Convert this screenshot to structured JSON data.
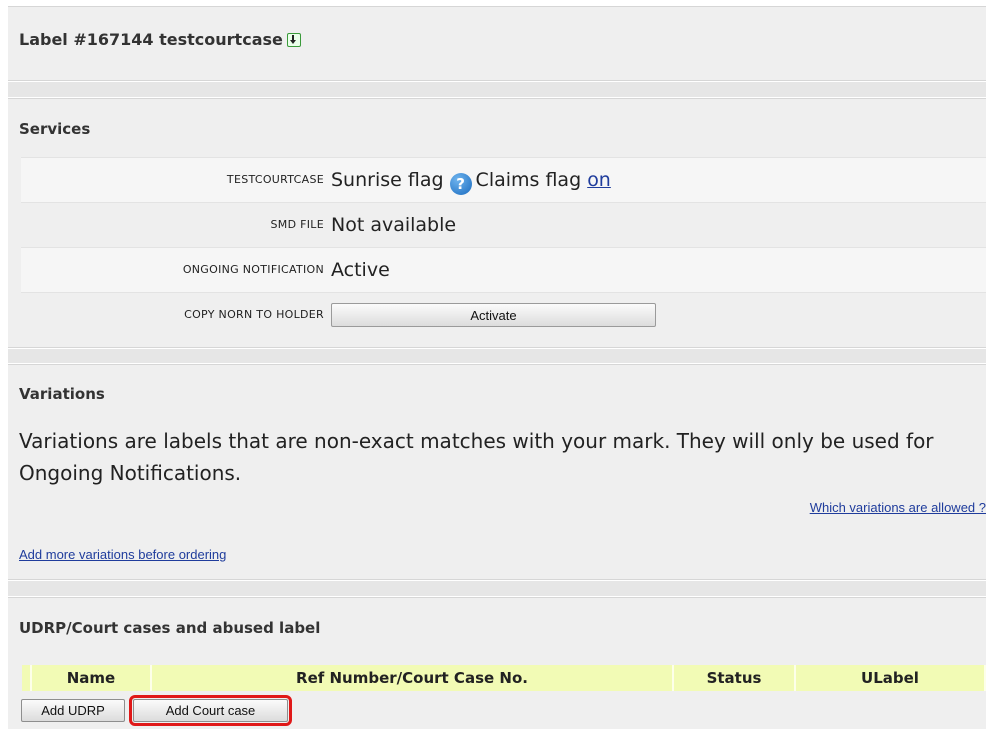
{
  "label_section": {
    "title": "Label #167144 testcourtcase",
    "icon": "download-icon"
  },
  "services": {
    "title": "Services",
    "rows": [
      {
        "label": "TESTCOURTCASE",
        "value_prefix": "Sunrise flag",
        "help_icon": "question-circle-icon",
        "value_mid": "Claims flag",
        "link": "on"
      },
      {
        "label": "SMD FILE",
        "value": "Not available"
      },
      {
        "label": "ONGOING NOTIFICATION",
        "value": "Active"
      },
      {
        "label": "COPY NORN TO HOLDER",
        "button": "Activate"
      }
    ]
  },
  "variations": {
    "title": "Variations",
    "description": "Variations are labels that are non-exact matches with your mark. They will only be used for Ongoing Notifications.",
    "allowed_link": "Which variations are allowed ?",
    "more_link": "Add more variations before ordering"
  },
  "udrp": {
    "title": "UDRP/Court cases and abused label",
    "columns": [
      "Name",
      "Ref Number/Court Case No.",
      "Status",
      "ULabel"
    ],
    "add_udrp": "Add UDRP",
    "add_court_case": "Add Court case"
  },
  "colors": {
    "panel_bg": "#efefef",
    "table_header_bg": "#f2fbb5",
    "link": "#1f3c9c",
    "highlight": "#e01818"
  }
}
